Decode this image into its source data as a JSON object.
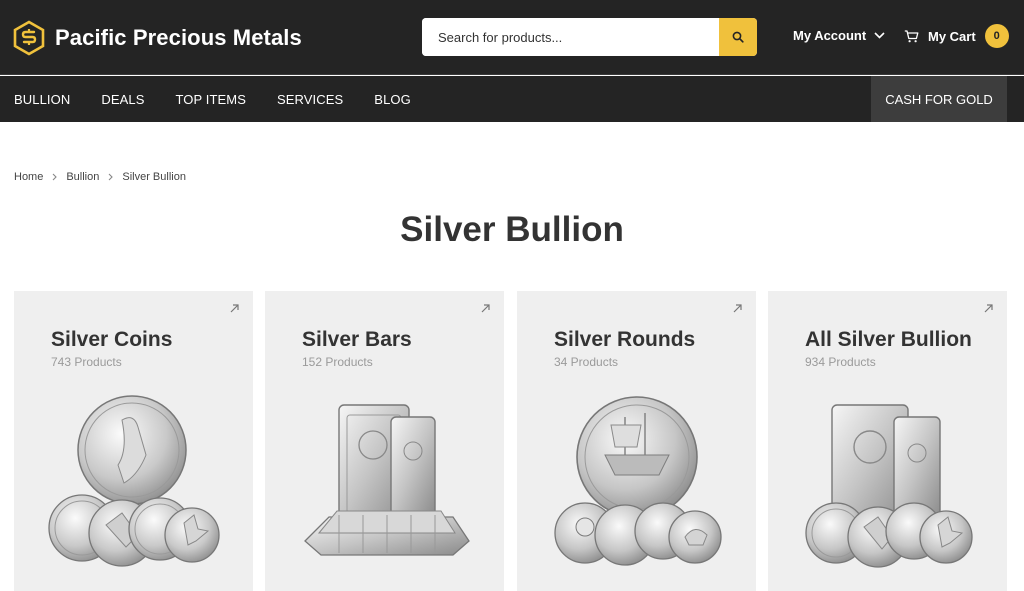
{
  "header": {
    "brand": "Pacific Precious Metals",
    "search_placeholder": "Search for products...",
    "account_label": "My Account",
    "cart_label": "My Cart",
    "cart_count": "0"
  },
  "nav": {
    "items": [
      {
        "label": "BULLION"
      },
      {
        "label": "DEALS"
      },
      {
        "label": "TOP ITEMS"
      },
      {
        "label": "SERVICES"
      },
      {
        "label": "BLOG"
      }
    ],
    "cta_label": "CASH FOR GOLD"
  },
  "breadcrumb": [
    "Home",
    "Bullion",
    "Silver Bullion"
  ],
  "page": {
    "title": "Silver Bullion"
  },
  "categories": [
    {
      "title": "Silver Coins",
      "count": "743 Products",
      "icon": "silver-coins-image"
    },
    {
      "title": "Silver Bars",
      "count": "152 Products",
      "icon": "silver-bars-image"
    },
    {
      "title": "Silver Rounds",
      "count": "34 Products",
      "icon": "silver-rounds-image"
    },
    {
      "title": "All Silver Bullion",
      "count": "934 Products",
      "icon": "all-silver-bullion-image"
    }
  ],
  "colors": {
    "header_bg": "#242424",
    "accent": "#f0c13c",
    "cta_bg": "#3d3d3d",
    "card_bg": "#efefef"
  }
}
